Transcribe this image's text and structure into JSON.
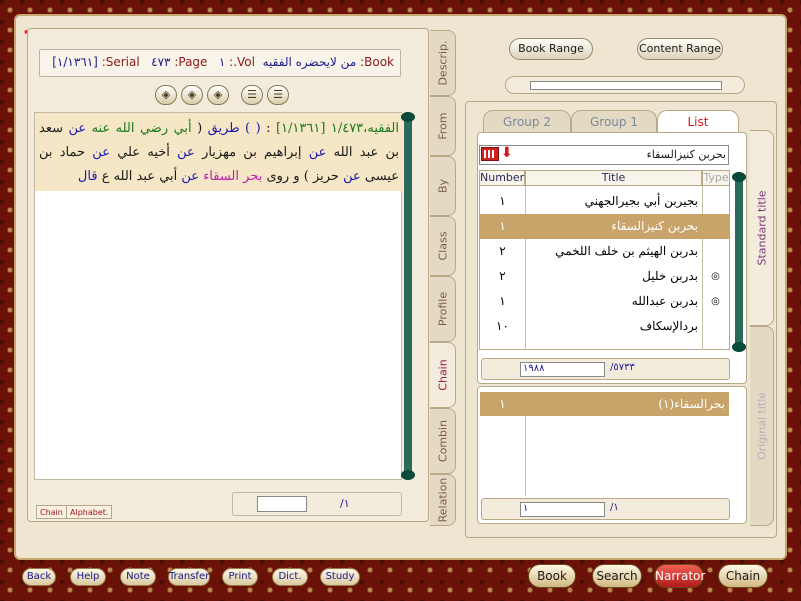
{
  "book_info": {
    "book_label": "Book:",
    "book_value": "من لايحضره الفقيه",
    "vol_label": "Vol.:",
    "vol_value": "١",
    "page_label": "Page:",
    "page_value": "٤٧٣",
    "serial_label": "Serial:",
    "serial_value": "[١/١٣٦١]"
  },
  "toolbar": {
    "icons": [
      "◈",
      "◈",
      "◈",
      "☰",
      "☰"
    ]
  },
  "hadith": {
    "ref": "الفقيه،١/٤٧٣ [١/١٣٦١]",
    "colon": " : ",
    "p1": "( ) طريق",
    "p2": " ( ",
    "p3": "أبي رضي الله عنه",
    "p4": " عن ",
    "p5": "سعد بن عبد الله",
    "p6": " عن ",
    "p7": "إبراهيم بن مهزيار",
    "p8": " عن ",
    "p9": "أخيه علي",
    "p10": " عن ",
    "p11": "حماد بن عيسى",
    "p12": " عن ",
    "p13": "حريز",
    "p14": " ) و روى ",
    "p15": "بحر السقاء",
    "p16": " عن ",
    "p17": "أبي عبد الله ع",
    "p18": " قال"
  },
  "left_bottom": {
    "tab_chain": "Chain",
    "tab_alphabet": "Alphabet.",
    "page_total": "/١"
  },
  "vertical_tabs": [
    "Descrip.",
    "From",
    "By",
    "Class",
    "Profile",
    "Chain",
    "Combin",
    "Relation"
  ],
  "range_buttons": {
    "book_range": "Book Range",
    "content_range": "Content Range"
  },
  "list_tabs": {
    "group2": "Group 2",
    "group1": "Group 1",
    "list": "List"
  },
  "search": {
    "value": "بحربن كنيزالسقاء"
  },
  "table": {
    "headers": [
      "Number",
      "Title",
      "Type"
    ],
    "rows": [
      {
        "number": "١",
        "title": "بجيربن أبي بجيرالجهني",
        "type": ""
      },
      {
        "number": "١",
        "title": "بحربن كنيزالسقاء",
        "type": ""
      },
      {
        "number": "٢",
        "title": "بدربن الهيثم بن خلف اللخمي",
        "type": ""
      },
      {
        "number": "٢",
        "title": "بدربن خليل",
        "type": "◎"
      },
      {
        "number": "١",
        "title": "بدربن عبدالله",
        "type": "◎"
      },
      {
        "number": "١٠",
        "title": "بردالإسكاف",
        "type": ""
      }
    ]
  },
  "list_counter": {
    "current": "١٩٨٨",
    "total": "/٥٧٣٣"
  },
  "original_list": {
    "row_number": "١",
    "row_title": "بحرالسقاء(١)",
    "pager_current": "١",
    "pager_total": "/١"
  },
  "side_tabs": {
    "standard_title": "Standard title",
    "original_title": "Original title"
  },
  "bottom_buttons": [
    "Back",
    "Help",
    "Note",
    "Transfer",
    "Print",
    "Dict.",
    "Study"
  ],
  "nav_buttons": [
    "Book",
    "Search",
    "Narrator",
    "Chain"
  ],
  "colors": {
    "accent_red": "#d01a1a",
    "selected_row": "#c9a46a",
    "frame": "#6a1208"
  }
}
